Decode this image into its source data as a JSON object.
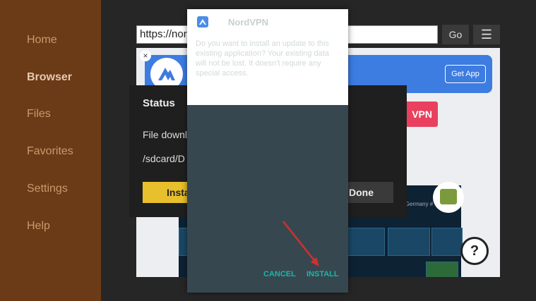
{
  "sidebar": {
    "items": [
      {
        "label": "Home",
        "active": false
      },
      {
        "label": "Browser",
        "active": true
      },
      {
        "label": "Files",
        "active": false
      },
      {
        "label": "Favorites",
        "active": false
      },
      {
        "label": "Settings",
        "active": false
      },
      {
        "label": "Help",
        "active": false
      }
    ]
  },
  "browser": {
    "url": "https://nor",
    "go_label": "Go",
    "menu_icon": "hamburger-menu-icon"
  },
  "webpage": {
    "ad": {
      "close_symbol": "×",
      "letter": "N",
      "get_app_label": "Get App"
    },
    "vpn_button_label": "VPN",
    "map_caption": "o Germany #"
  },
  "status_dialog": {
    "title": "Status",
    "line1": "File downl",
    "line2": "/sdcard/D",
    "install_label": "Insta",
    "done_label": "Done"
  },
  "installer": {
    "app_name": "NordVPN",
    "description": "Do you want to install an update to this existing application? Your existing data will not be lost. It doesn't require any special access.",
    "cancel_label": "CANCEL",
    "install_label": "INSTALL"
  },
  "colors": {
    "sidebar_bg": "#6b3a16",
    "accent_teal": "#1db5a8",
    "install_yellow": "#e8c02c",
    "annotation_red": "#d32f2f"
  }
}
